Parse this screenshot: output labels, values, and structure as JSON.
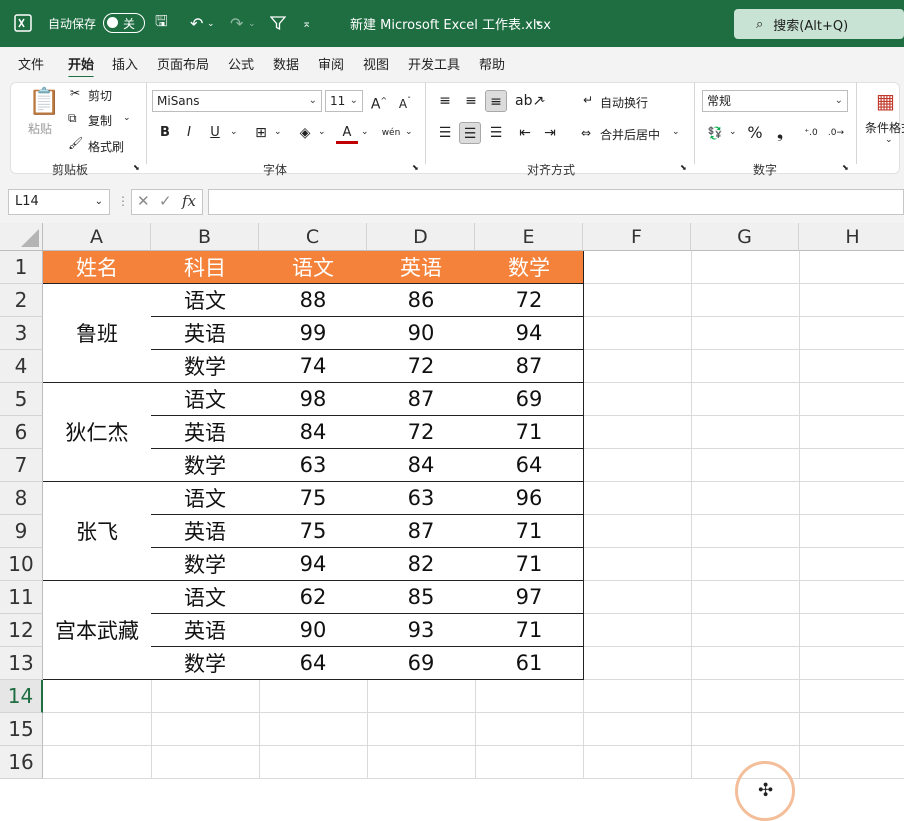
{
  "titlebar": {
    "autosave_label": "自动保存",
    "autosave_state": "关",
    "file_title": "新建 Microsoft Excel 工作表.xlsx",
    "search_placeholder": "搜索(Alt+Q)"
  },
  "menu_tabs": [
    "文件",
    "开始",
    "插入",
    "页面布局",
    "公式",
    "数据",
    "审阅",
    "视图",
    "开发工具",
    "帮助"
  ],
  "active_tab": "开始",
  "ribbon": {
    "clipboard": {
      "paste": "粘贴",
      "cut": "剪切",
      "copy": "复制",
      "format_painter": "格式刷",
      "label": "剪贴板"
    },
    "font": {
      "font_name": "MiSans",
      "font_size": "11",
      "label": "字体"
    },
    "alignment": {
      "wrap": "自动换行",
      "merge": "合并后居中",
      "label": "对齐方式"
    },
    "number": {
      "format": "常规",
      "label": "数字"
    },
    "styles": {
      "conditional": "条件格式"
    }
  },
  "formula_bar": {
    "name_box": "L14",
    "fx": "fx",
    "value": ""
  },
  "columns": [
    "A",
    "B",
    "C",
    "D",
    "E",
    "F",
    "G",
    "H"
  ],
  "rows": [
    "1",
    "2",
    "3",
    "4",
    "5",
    "6",
    "7",
    "8",
    "9",
    "10",
    "11",
    "12",
    "13",
    "14",
    "15",
    "16"
  ],
  "selected_row": "14",
  "table": {
    "headers": [
      "姓名",
      "科目",
      "语文",
      "英语",
      "数学"
    ],
    "groups": [
      {
        "name": "鲁班",
        "rows": [
          [
            "语文",
            "88",
            "86",
            "72"
          ],
          [
            "英语",
            "99",
            "90",
            "94"
          ],
          [
            "数学",
            "74",
            "72",
            "87"
          ]
        ]
      },
      {
        "name": "狄仁杰",
        "rows": [
          [
            "语文",
            "98",
            "87",
            "69"
          ],
          [
            "英语",
            "84",
            "72",
            "71"
          ],
          [
            "数学",
            "63",
            "84",
            "64"
          ]
        ]
      },
      {
        "name": "张飞",
        "rows": [
          [
            "语文",
            "75",
            "63",
            "96"
          ],
          [
            "英语",
            "75",
            "87",
            "71"
          ],
          [
            "数学",
            "94",
            "82",
            "71"
          ]
        ]
      },
      {
        "name": "宫本武藏",
        "rows": [
          [
            "语文",
            "62",
            "85",
            "97"
          ],
          [
            "英语",
            "90",
            "93",
            "71"
          ],
          [
            "数学",
            "64",
            "69",
            "61"
          ]
        ]
      }
    ]
  },
  "colors": {
    "title_green": "#1e6e42",
    "header_orange": "#f5823a",
    "cursor_ring": "#f3be99"
  }
}
